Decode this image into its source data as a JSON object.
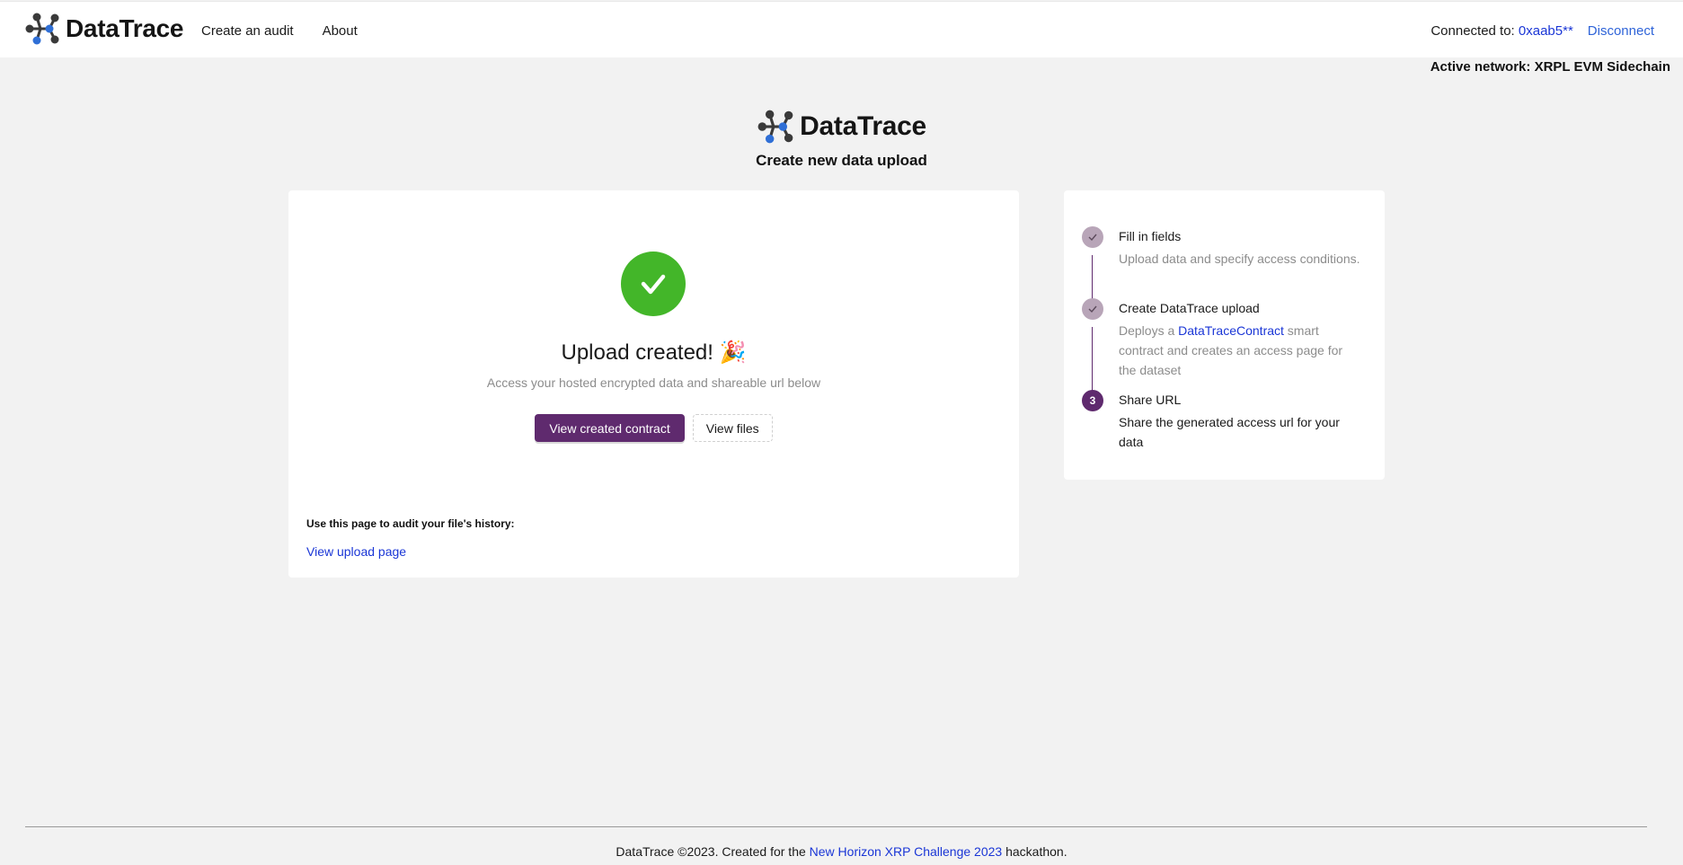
{
  "app": {
    "name": "DataTrace"
  },
  "header": {
    "nav": [
      {
        "label": "Create an audit"
      },
      {
        "label": "About"
      }
    ],
    "connected_label": "Connected to:",
    "address": "0xaab5**",
    "disconnect_label": "Disconnect",
    "network_text": "Active network: XRPL EVM Sidechain"
  },
  "hero": {
    "title": "DataTrace",
    "subtitle": "Create new data upload"
  },
  "result": {
    "icon": "check-circle-icon",
    "title": "Upload created! 🎉",
    "description": "Access your hosted encrypted data and shareable url below",
    "primary_button": "View created contract",
    "secondary_button": "View files",
    "audit_label": "Use this page to audit your file's history:",
    "upload_link": "View upload page"
  },
  "steps": [
    {
      "status": "done",
      "title": "Fill in fields",
      "description": "Upload data and specify access conditions."
    },
    {
      "status": "done",
      "title": "Create DataTrace upload",
      "desc_before": "Deploys a ",
      "desc_link": "DataTraceContract",
      "desc_after": " smart contract and creates an access page for the dataset"
    },
    {
      "status": "active",
      "number": "3",
      "title": "Share URL",
      "description": "Share the generated access url for your data"
    }
  ],
  "footer": {
    "text_before": "DataTrace ©2023. Created for the ",
    "link": "New Horizon XRP Challenge 2023",
    "text_after": " hackathon."
  },
  "colors": {
    "brand_purple": "#5f2a6e",
    "success_green": "#43b629",
    "link_blue": "#1a36d6",
    "background": "#f2f2f2"
  }
}
